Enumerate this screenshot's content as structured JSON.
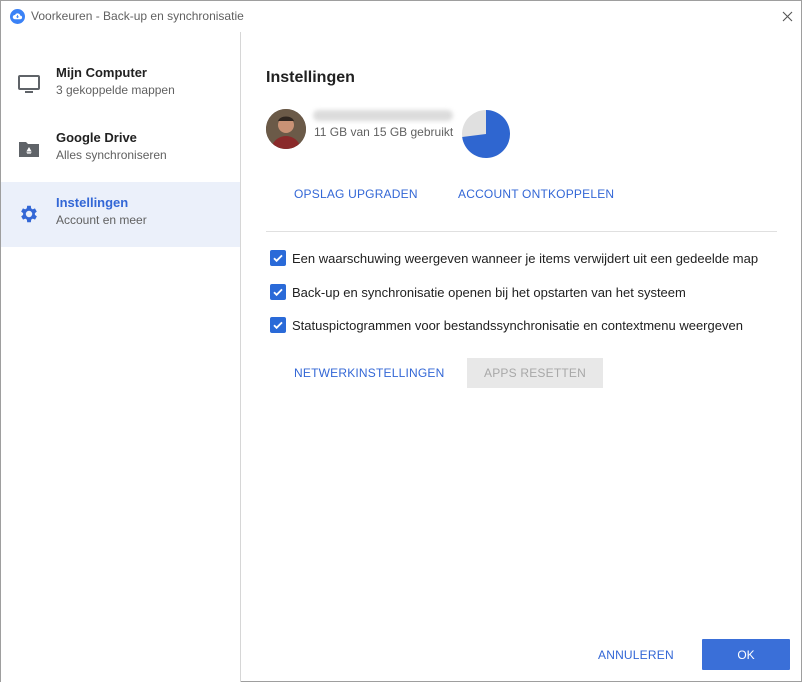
{
  "window": {
    "title": "Voorkeuren - Back-up en synchronisatie"
  },
  "sidebar": {
    "items": [
      {
        "title": "Mijn Computer",
        "subtitle": "3 gekoppelde mappen",
        "icon": "monitor-icon"
      },
      {
        "title": "Google Drive",
        "subtitle": "Alles synchroniseren",
        "icon": "drive-folder-icon"
      },
      {
        "title": "Instellingen",
        "subtitle": "Account en meer",
        "icon": "gear-icon",
        "active": true
      }
    ]
  },
  "main": {
    "heading": "Instellingen",
    "account": {
      "storage_text": "11 GB van 15 GB gebruikt",
      "storage_used_fraction": 0.73
    },
    "upgrade_label": "OPSLAG UPGRADEN",
    "disconnect_label": "ACCOUNT ONTKOPPELEN",
    "options": [
      {
        "label": "Een waarschuwing weergeven wanneer je items verwijdert uit een gedeelde map",
        "checked": true
      },
      {
        "label": "Back-up en synchronisatie openen bij het opstarten van het systeem",
        "checked": true
      },
      {
        "label": "Statuspictogrammen voor bestandssynchronisatie en contextmenu weergeven",
        "checked": true
      }
    ],
    "network_label": "NETWERKINSTELLINGEN",
    "reset_label": "APPS RESETTEN"
  },
  "footer": {
    "cancel_label": "ANNULEREN",
    "ok_label": "OK"
  },
  "colors": {
    "accent": "#3367d6",
    "pie_used": "#2f66d0",
    "pie_free": "#e0e0e0",
    "active_bg": "#ebf0fa"
  }
}
